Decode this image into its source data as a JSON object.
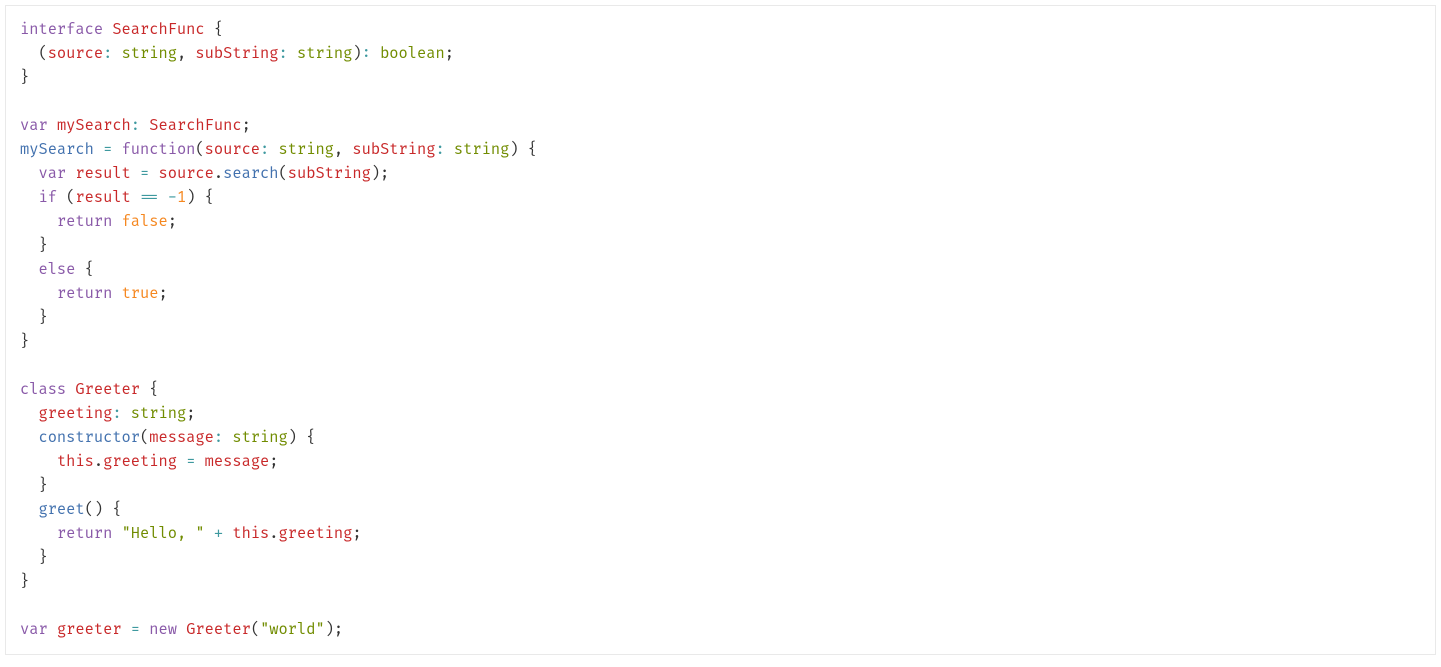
{
  "colors": {
    "keyword": "#8959a8",
    "identifier": "#c82829",
    "builtin": "#718c00",
    "function": "#4271ae",
    "punct": "#333333",
    "operator": "#3e999f",
    "number": "#f5871f",
    "string": "#718c00",
    "border": "#e9e9e9",
    "background": "#ffffff"
  },
  "code": {
    "language": "typescript",
    "tokens": [
      [
        {
          "t": "kw",
          "v": "interface"
        },
        {
          "t": "punc",
          "v": " "
        },
        {
          "t": "id",
          "v": "SearchFunc"
        },
        {
          "t": "punc",
          "v": " {"
        }
      ],
      [
        {
          "t": "punc",
          "v": "  ("
        },
        {
          "t": "id",
          "v": "source"
        },
        {
          "t": "op",
          "v": ": "
        },
        {
          "t": "builtin",
          "v": "string"
        },
        {
          "t": "punc",
          "v": ", "
        },
        {
          "t": "id",
          "v": "subString"
        },
        {
          "t": "op",
          "v": ": "
        },
        {
          "t": "builtin",
          "v": "string"
        },
        {
          "t": "punc",
          "v": ")"
        },
        {
          "t": "op",
          "v": ": "
        },
        {
          "t": "builtin",
          "v": "boolean"
        },
        {
          "t": "punc",
          "v": ";"
        }
      ],
      [
        {
          "t": "punc",
          "v": "}"
        }
      ],
      [
        {
          "t": "punc",
          "v": ""
        }
      ],
      [
        {
          "t": "kw",
          "v": "var"
        },
        {
          "t": "punc",
          "v": " "
        },
        {
          "t": "id",
          "v": "mySearch"
        },
        {
          "t": "op",
          "v": ": "
        },
        {
          "t": "id",
          "v": "SearchFunc"
        },
        {
          "t": "punc",
          "v": ";"
        }
      ],
      [
        {
          "t": "func",
          "v": "mySearch"
        },
        {
          "t": "punc",
          "v": " "
        },
        {
          "t": "op",
          "v": "="
        },
        {
          "t": "punc",
          "v": " "
        },
        {
          "t": "kw",
          "v": "function"
        },
        {
          "t": "punc",
          "v": "("
        },
        {
          "t": "id",
          "v": "source"
        },
        {
          "t": "op",
          "v": ": "
        },
        {
          "t": "builtin",
          "v": "string"
        },
        {
          "t": "punc",
          "v": ", "
        },
        {
          "t": "id",
          "v": "subString"
        },
        {
          "t": "op",
          "v": ": "
        },
        {
          "t": "builtin",
          "v": "string"
        },
        {
          "t": "punc",
          "v": ") {"
        }
      ],
      [
        {
          "t": "punc",
          "v": "  "
        },
        {
          "t": "kw",
          "v": "var"
        },
        {
          "t": "punc",
          "v": " "
        },
        {
          "t": "id",
          "v": "result"
        },
        {
          "t": "punc",
          "v": " "
        },
        {
          "t": "op",
          "v": "="
        },
        {
          "t": "punc",
          "v": " "
        },
        {
          "t": "id",
          "v": "source"
        },
        {
          "t": "punc",
          "v": "."
        },
        {
          "t": "func",
          "v": "search"
        },
        {
          "t": "punc",
          "v": "("
        },
        {
          "t": "id",
          "v": "subString"
        },
        {
          "t": "punc",
          "v": ");"
        }
      ],
      [
        {
          "t": "punc",
          "v": "  "
        },
        {
          "t": "kw",
          "v": "if"
        },
        {
          "t": "punc",
          "v": " ("
        },
        {
          "t": "id",
          "v": "result"
        },
        {
          "t": "punc",
          "v": " "
        },
        {
          "t": "op",
          "v": "=="
        },
        {
          "t": "punc",
          "v": " "
        },
        {
          "t": "op",
          "v": "-"
        },
        {
          "t": "num",
          "v": "1"
        },
        {
          "t": "punc",
          "v": ") {"
        }
      ],
      [
        {
          "t": "punc",
          "v": "    "
        },
        {
          "t": "kw",
          "v": "return"
        },
        {
          "t": "punc",
          "v": " "
        },
        {
          "t": "num",
          "v": "false"
        },
        {
          "t": "punc",
          "v": ";"
        }
      ],
      [
        {
          "t": "punc",
          "v": "  }"
        }
      ],
      [
        {
          "t": "punc",
          "v": "  "
        },
        {
          "t": "kw",
          "v": "else"
        },
        {
          "t": "punc",
          "v": " {"
        }
      ],
      [
        {
          "t": "punc",
          "v": "    "
        },
        {
          "t": "kw",
          "v": "return"
        },
        {
          "t": "punc",
          "v": " "
        },
        {
          "t": "num",
          "v": "true"
        },
        {
          "t": "punc",
          "v": ";"
        }
      ],
      [
        {
          "t": "punc",
          "v": "  }"
        }
      ],
      [
        {
          "t": "punc",
          "v": "}"
        }
      ],
      [
        {
          "t": "punc",
          "v": ""
        }
      ],
      [
        {
          "t": "kw",
          "v": "class"
        },
        {
          "t": "punc",
          "v": " "
        },
        {
          "t": "id",
          "v": "Greeter"
        },
        {
          "t": "punc",
          "v": " {"
        }
      ],
      [
        {
          "t": "punc",
          "v": "  "
        },
        {
          "t": "id",
          "v": "greeting"
        },
        {
          "t": "op",
          "v": ": "
        },
        {
          "t": "builtin",
          "v": "string"
        },
        {
          "t": "punc",
          "v": ";"
        }
      ],
      [
        {
          "t": "punc",
          "v": "  "
        },
        {
          "t": "func",
          "v": "constructor"
        },
        {
          "t": "punc",
          "v": "("
        },
        {
          "t": "id",
          "v": "message"
        },
        {
          "t": "op",
          "v": ": "
        },
        {
          "t": "builtin",
          "v": "string"
        },
        {
          "t": "punc",
          "v": ") {"
        }
      ],
      [
        {
          "t": "punc",
          "v": "    "
        },
        {
          "t": "this",
          "v": "this"
        },
        {
          "t": "punc",
          "v": "."
        },
        {
          "t": "id",
          "v": "greeting"
        },
        {
          "t": "punc",
          "v": " "
        },
        {
          "t": "op",
          "v": "="
        },
        {
          "t": "punc",
          "v": " "
        },
        {
          "t": "id",
          "v": "message"
        },
        {
          "t": "punc",
          "v": ";"
        }
      ],
      [
        {
          "t": "punc",
          "v": "  }"
        }
      ],
      [
        {
          "t": "punc",
          "v": "  "
        },
        {
          "t": "func",
          "v": "greet"
        },
        {
          "t": "punc",
          "v": "() {"
        }
      ],
      [
        {
          "t": "punc",
          "v": "    "
        },
        {
          "t": "kw",
          "v": "return"
        },
        {
          "t": "punc",
          "v": " "
        },
        {
          "t": "str",
          "v": "\"Hello, \""
        },
        {
          "t": "punc",
          "v": " "
        },
        {
          "t": "op",
          "v": "+"
        },
        {
          "t": "punc",
          "v": " "
        },
        {
          "t": "this",
          "v": "this"
        },
        {
          "t": "punc",
          "v": "."
        },
        {
          "t": "id",
          "v": "greeting"
        },
        {
          "t": "punc",
          "v": ";"
        }
      ],
      [
        {
          "t": "punc",
          "v": "  }"
        }
      ],
      [
        {
          "t": "punc",
          "v": "}"
        }
      ],
      [
        {
          "t": "punc",
          "v": ""
        }
      ],
      [
        {
          "t": "kw",
          "v": "var"
        },
        {
          "t": "punc",
          "v": " "
        },
        {
          "t": "id",
          "v": "greeter"
        },
        {
          "t": "punc",
          "v": " "
        },
        {
          "t": "op",
          "v": "="
        },
        {
          "t": "punc",
          "v": " "
        },
        {
          "t": "kw",
          "v": "new"
        },
        {
          "t": "punc",
          "v": " "
        },
        {
          "t": "id",
          "v": "Greeter"
        },
        {
          "t": "punc",
          "v": "("
        },
        {
          "t": "str",
          "v": "\"world\""
        },
        {
          "t": "punc",
          "v": ");"
        }
      ]
    ]
  }
}
